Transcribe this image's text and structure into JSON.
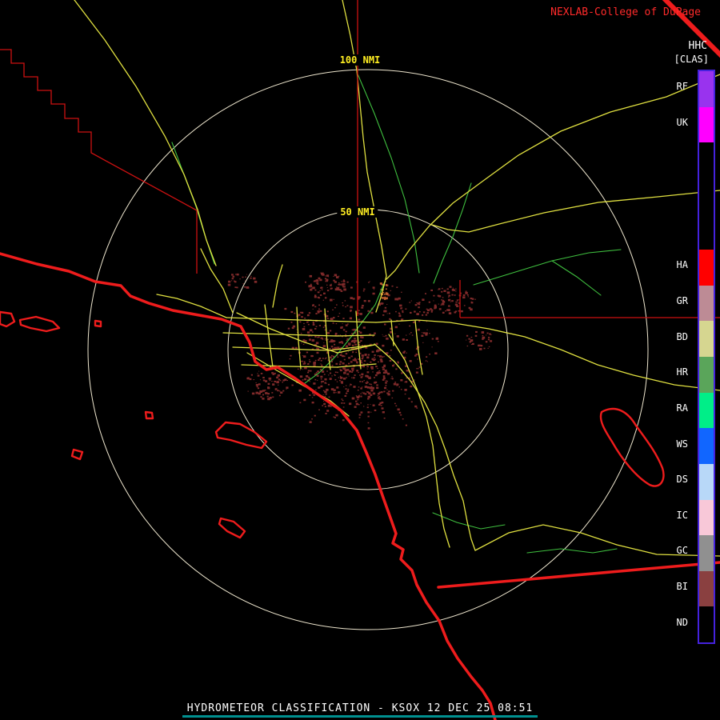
{
  "header": {
    "attribution": "NEXLAB-College of DuPage",
    "product_short": "HHC",
    "product_tag": "[CLAS]"
  },
  "radar": {
    "site": "KSOX",
    "range_ring_inner_label": "50 NMI",
    "range_ring_outer_label": "100 NMI"
  },
  "legend": {
    "slots": [
      {
        "label": "RF",
        "color": "#9933ee"
      },
      {
        "label": "UK",
        "color": "#ff00ff"
      },
      {
        "label": "",
        "color": "#000000"
      },
      {
        "label": "",
        "color": "#000000"
      },
      {
        "label": "",
        "color": "#000000"
      },
      {
        "label": "HA",
        "color": "#ff0000"
      },
      {
        "label": "GR",
        "color": "#bd8b95"
      },
      {
        "label": "BD",
        "color": "#d6d690"
      },
      {
        "label": "HR",
        "color": "#5aa55a"
      },
      {
        "label": "RA",
        "color": "#00ee88"
      },
      {
        "label": "WS",
        "color": "#1166ff"
      },
      {
        "label": "DS",
        "color": "#b8d8f8"
      },
      {
        "label": "IC",
        "color": "#f8c8d8"
      },
      {
        "label": "GC",
        "color": "#909090"
      },
      {
        "label": "BI",
        "color": "#8a4040"
      },
      {
        "label": "ND",
        "color": "#000000"
      }
    ]
  },
  "footer": {
    "title": "HYDROMETEOR CLASSIFICATION - KSOX 12 DEC 25 08:51"
  },
  "colors": {
    "bg": "#000000",
    "attribution": "#ff2a2a",
    "text": "#ffffff",
    "ring": "#efe7cf",
    "ring-label": "#ffee22",
    "road": "#e0e040",
    "county": "#cc1111",
    "coast": "#ee1c1c",
    "river": "#3fbf3f",
    "echo": "#7f2a2a",
    "echo-bright": "#c06030",
    "legend-border": "#4422dd",
    "footer-line": "#009090"
  }
}
